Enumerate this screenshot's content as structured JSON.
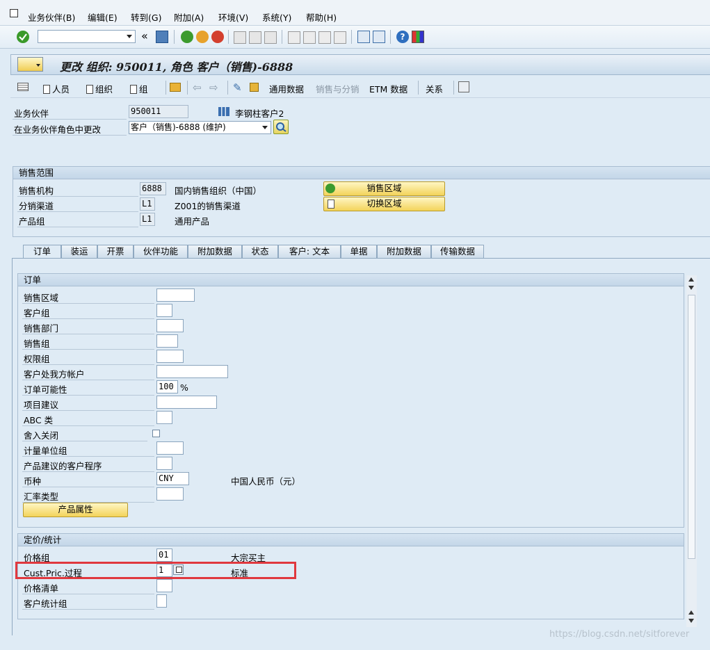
{
  "menu": [
    "业务伙伴(B)",
    "编辑(E)",
    "转到(G)",
    "附加(A)",
    "环境(V)",
    "系统(Y)",
    "帮助(H)"
  ],
  "title": "更改 组织: 950011, 角色 客户（销售)-6888",
  "app_toolbar": {
    "person": "人员",
    "org": "组织",
    "group": "组",
    "general_data": "通用数据",
    "sales_dist": "销售与分销",
    "etm_data": "ETM 数据",
    "relations": "关系"
  },
  "header_fields": {
    "bp_label": "业务伙伴",
    "bp_value": "950011",
    "bp_name": "李钢柱客户2",
    "role_label": "在业务伙伴角色中更改",
    "role_value": "客户（销售)-6888 (维护)"
  },
  "sales_area": {
    "title": "销售范围",
    "org_label": "销售机构",
    "org_value": "6888",
    "org_desc": "国内销售组织（中国）",
    "channel_label": "分销渠道",
    "channel_value": "L1",
    "channel_desc": "Z001的销售渠道",
    "division_label": "产品组",
    "division_value": "L1",
    "division_desc": "通用产品",
    "btn_sales_area": "销售区域",
    "btn_switch_area": "切换区域"
  },
  "tabs": [
    "订单",
    "装运",
    "开票",
    "伙伴功能",
    "附加数据",
    "状态",
    "客户: 文本",
    "单据",
    "附加数据",
    "传输数据"
  ],
  "orders": {
    "title": "订单",
    "rows": [
      {
        "label": "销售区域",
        "value": ""
      },
      {
        "label": "客户组",
        "value": ""
      },
      {
        "label": "销售部门",
        "value": ""
      },
      {
        "label": "销售组",
        "value": ""
      },
      {
        "label": "权限组",
        "value": ""
      },
      {
        "label": "客户处我方帐户",
        "value": ""
      },
      {
        "label": "订单可能性",
        "value": "100",
        "unit": "%"
      },
      {
        "label": "项目建议",
        "value": ""
      },
      {
        "label": "ABC 类",
        "value": ""
      },
      {
        "label": "舍入关闭",
        "value": ""
      },
      {
        "label": "计量单位组",
        "value": ""
      },
      {
        "label": "产品建议的客户程序",
        "value": ""
      },
      {
        "label": "币种",
        "value": "CNY",
        "desc": "中国人民币（元）"
      },
      {
        "label": "汇率类型",
        "value": ""
      }
    ],
    "btn_product_attr": "产品属性"
  },
  "pricing": {
    "title": "定价/统计",
    "price_group_label": "价格组",
    "price_group_value": "01",
    "price_group_desc": "大宗买主",
    "cust_pric_label": "Cust.Pric.过程",
    "cust_pric_value": "1",
    "cust_pric_desc": "标准",
    "price_list_label": "价格清单",
    "price_list_value": "",
    "stat_group_label": "客户统计组",
    "stat_group_value": ""
  },
  "watermark": "https://blog.csdn.net/sitforever",
  "colors": {
    "highlight": "#e0383e",
    "button_yellow": "#f3d35a"
  }
}
